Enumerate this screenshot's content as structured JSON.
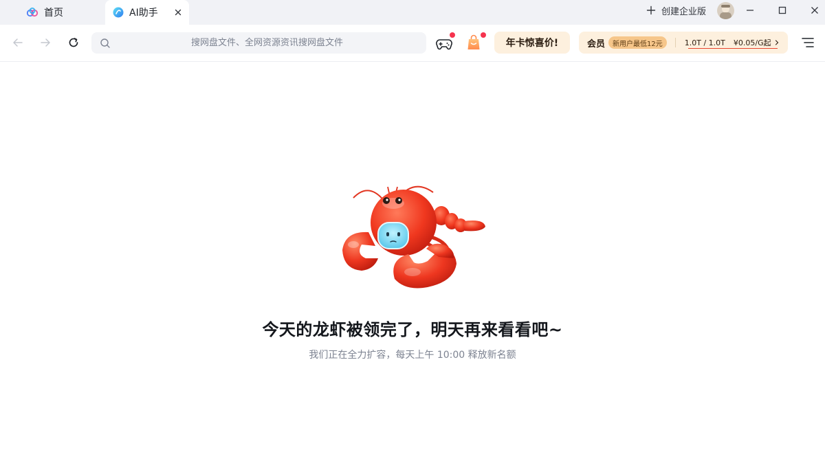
{
  "tabs": [
    {
      "label": "首页",
      "icon": "cloud-logo-icon"
    },
    {
      "label": "AI助手",
      "icon": "ai-assistant-icon",
      "active": true
    }
  ],
  "titlebar": {
    "create_enterprise": "创建企业版",
    "avatar": "avatar"
  },
  "toolbar": {
    "search_placeholder": "搜网盘文件、全网资源资讯搜网盘文件",
    "promo_label": "年卡惊喜价!",
    "vip": {
      "label": "会员",
      "badge": "新用户最低12元",
      "storage": "1.0T / 1.0T",
      "price": "¥0.05/G起"
    }
  },
  "colors": {
    "accent_red": "#f5334e",
    "promo_bg": "#fdf0de",
    "badge_bg": "#f6c68a",
    "tab_bar_bg": "#f1f2f6"
  },
  "empty_state": {
    "title": "今天的龙虾被领完了，明天再来看看吧~",
    "subtitle": "我们正在全力扩容，每天上午 10:00 释放新名额",
    "illustration": "lobster-mascot"
  }
}
